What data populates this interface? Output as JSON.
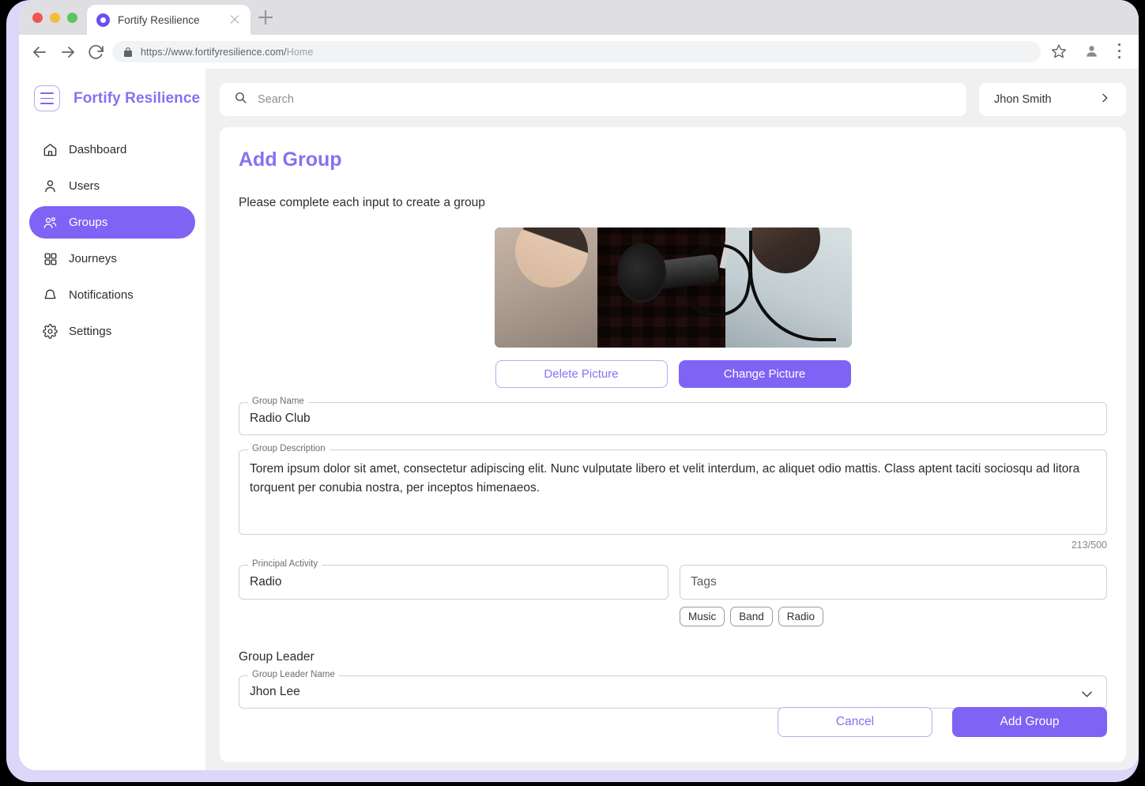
{
  "browser": {
    "tab_title": "Fortify Resilience",
    "url_domain": "https://www.fortifyresilience.com/",
    "url_path": "Home",
    "favicon": "target-icon",
    "new_tab_label": "+"
  },
  "sidebar": {
    "brand": "Fortify Resilience",
    "menu_toggle": "hamburger-icon",
    "items": [
      {
        "label": "Dashboard",
        "icon": "home-icon",
        "active": false
      },
      {
        "label": "Users",
        "icon": "user-icon",
        "active": false
      },
      {
        "label": "Groups",
        "icon": "users-group-icon",
        "active": true
      },
      {
        "label": "Journeys",
        "icon": "grid-icon",
        "active": false
      },
      {
        "label": "Notifications",
        "icon": "bell-icon",
        "active": false
      },
      {
        "label": "Settings",
        "icon": "gear-icon",
        "active": false
      }
    ]
  },
  "topbar": {
    "search_placeholder": "Search",
    "search_value": "",
    "search_icon": "search-icon",
    "user_name": "Jhon Smith",
    "user_chevron": "chevron-right-icon"
  },
  "page": {
    "title": "Add Group",
    "subtitle": "Please complete each input to create a group"
  },
  "picture": {
    "alt": "podcast-studio-photo",
    "delete_label": "Delete Picture",
    "change_label": "Change Picture"
  },
  "form": {
    "group_name": {
      "label": "Group Name",
      "value": "Radio Club"
    },
    "group_description": {
      "label": "Group Description",
      "value": "Torem ipsum dolor sit amet, consectetur adipiscing elit. Nunc vulputate libero et velit interdum, ac aliquet odio mattis. Class aptent taciti sociosqu ad litora torquent per conubia nostra, per inceptos himenaeos.",
      "counter": "213/500"
    },
    "principal_activity": {
      "label": "Principal Activity",
      "value": "Radio"
    },
    "tags": {
      "placeholder": "Tags",
      "value": "",
      "chips": [
        "Music",
        "Band",
        "Radio"
      ]
    },
    "group_leader": {
      "heading": "Group Leader",
      "label": "Group Leader Name",
      "value": "Jhon Lee",
      "chevron": "chevron-down-icon"
    }
  },
  "actions": {
    "cancel_label": "Cancel",
    "submit_label": "Add Group"
  },
  "colors": {
    "accent": "#7f63f4",
    "accent_text": "#8a6ff2",
    "frame": "#ddd6f8",
    "page_bg": "#f0f0f0"
  }
}
